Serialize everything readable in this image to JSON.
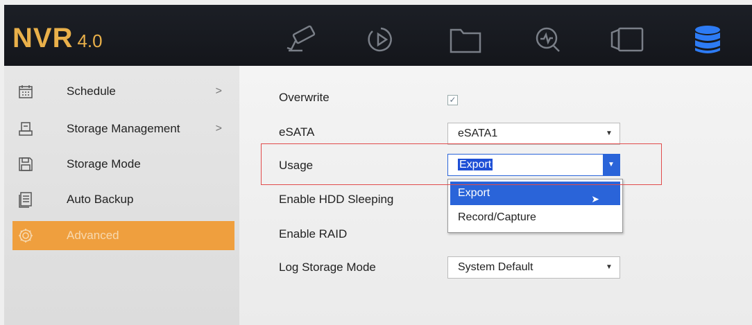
{
  "brand": {
    "name": "NVR",
    "version": "4.0"
  },
  "top_nav": [
    {
      "icon": "camera-icon"
    },
    {
      "icon": "playback-icon"
    },
    {
      "icon": "folder-icon"
    },
    {
      "icon": "search-icon"
    },
    {
      "icon": "video-camera-icon"
    },
    {
      "icon": "storage-database-icon",
      "active": true
    }
  ],
  "sidebar": {
    "items": [
      {
        "label": "Schedule",
        "icon": "calendar-icon",
        "chevron": ">"
      },
      {
        "label": "Storage Management",
        "icon": "hdd-icon",
        "chevron": ">"
      },
      {
        "label": "Storage Mode",
        "icon": "floppy-icon",
        "chevron": ""
      },
      {
        "label": "Auto Backup",
        "icon": "document-icon",
        "chevron": ""
      },
      {
        "label": "Advanced",
        "icon": "gear-icon",
        "chevron": "",
        "active": true
      }
    ]
  },
  "settings": {
    "overwrite": {
      "label": "Overwrite",
      "checked": true,
      "check_glyph": "✓"
    },
    "esata": {
      "label": "eSATA",
      "value": "eSATA1"
    },
    "usage": {
      "label": "Usage",
      "value": "Export",
      "options": [
        "Export",
        "Record/Capture"
      ]
    },
    "hdd_sleeping": {
      "label": "Enable HDD Sleeping"
    },
    "raid": {
      "label": "Enable RAID"
    },
    "log_storage": {
      "label": "Log Storage Mode",
      "value": "System Default"
    }
  },
  "colors": {
    "accent_orange": "#ef9f3e",
    "brand_gold": "#e9b04a",
    "selection_blue": "#2a64d9",
    "active_nav_blue": "#2d7bf4",
    "annotation_red": "#e14b4b"
  }
}
